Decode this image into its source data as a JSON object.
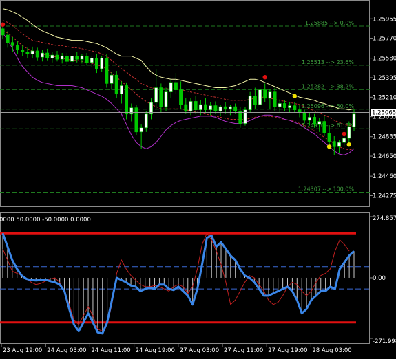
{
  "chart_data": [
    {
      "type": "candlestick",
      "panel": "price",
      "colors": {
        "background": "#000000",
        "bull": "#ffffff",
        "bear": "#00c800",
        "wick": "#00c800",
        "upper_band": "#f4f4a8",
        "lower_band": "#b030c8",
        "envelope": "#c03030",
        "fib": "#1f7a1f",
        "fib_text": "#3fa03f",
        "grid": "#8a8a8a",
        "marker_red": "#e01010",
        "marker_yellow": "#f0e000",
        "ask_line": "#9a9a9a"
      },
      "ylim": [
        1.2418,
        1.2612
      ],
      "y_ticks": [
        "1.25955",
        "1.25770",
        "1.25580",
        "1.25395",
        "1.25210",
        "1.25065",
        "1.24835",
        "1.24650",
        "1.24460",
        "1.24275"
      ],
      "y_tick_values": [
        1.25955,
        1.2577,
        1.2558,
        1.25395,
        1.2521,
        1.25025,
        1.24835,
        1.2465,
        1.2446,
        1.24275
      ],
      "current_price": 1.25065,
      "current_price_label": "1.25065",
      "fib_levels": [
        {
          "price": 1.25885,
          "label": "1.25885 --> 0.0%"
        },
        {
          "price": 1.25513,
          "label": "1.25513 --> 23.6%"
        },
        {
          "price": 1.25282,
          "label": "1.25282 --> 38.2%"
        },
        {
          "price": 1.25096,
          "label": "1.25096 --> 50.0%"
        },
        {
          "price": 1.2491,
          "label": "1.24910 --> 61.8%"
        },
        {
          "price": 1.24307,
          "label": "1.24307 --> 100.0%"
        }
      ],
      "candles": [
        [
          1.2586,
          1.2592,
          1.2576,
          1.258
        ],
        [
          1.258,
          1.2584,
          1.2568,
          1.2573
        ],
        [
          1.2573,
          1.2578,
          1.2564,
          1.257
        ],
        [
          1.257,
          1.2574,
          1.2562,
          1.2566
        ],
        [
          1.2566,
          1.257,
          1.256,
          1.2564
        ],
        [
          1.2564,
          1.2568,
          1.2558,
          1.2562
        ],
        [
          1.2562,
          1.2569,
          1.2558,
          1.2565
        ],
        [
          1.2565,
          1.2568,
          1.2556,
          1.2559
        ],
        [
          1.2559,
          1.2566,
          1.2555,
          1.2563
        ],
        [
          1.2563,
          1.2567,
          1.2556,
          1.2558
        ],
        [
          1.2558,
          1.2564,
          1.2554,
          1.2561
        ],
        [
          1.2561,
          1.2565,
          1.2555,
          1.2557
        ],
        [
          1.2557,
          1.2563,
          1.2553,
          1.256
        ],
        [
          1.256,
          1.2563,
          1.2552,
          1.2555
        ],
        [
          1.2555,
          1.2562,
          1.2552,
          1.256
        ],
        [
          1.256,
          1.2564,
          1.2554,
          1.2557
        ],
        [
          1.2557,
          1.2562,
          1.2553,
          1.256
        ],
        [
          1.256,
          1.2563,
          1.2551,
          1.2554
        ],
        [
          1.2554,
          1.256,
          1.255,
          1.2558
        ],
        [
          1.2558,
          1.2562,
          1.2544,
          1.2548
        ],
        [
          1.2548,
          1.256,
          1.2545,
          1.2558
        ],
        [
          1.2558,
          1.2562,
          1.253,
          1.2534
        ],
        [
          1.2534,
          1.2545,
          1.2528,
          1.2542
        ],
        [
          1.2542,
          1.2546,
          1.252,
          1.2524
        ],
        [
          1.2524,
          1.2536,
          1.2515,
          1.2532
        ],
        [
          1.2532,
          1.2535,
          1.25,
          1.2505
        ],
        [
          1.2505,
          1.2515,
          1.2498,
          1.2511
        ],
        [
          1.2511,
          1.2514,
          1.2485,
          1.2488
        ],
        [
          1.2488,
          1.2495,
          1.2472,
          1.2492
        ],
        [
          1.2492,
          1.2508,
          1.2488,
          1.2505
        ],
        [
          1.2505,
          1.252,
          1.25,
          1.2516
        ],
        [
          1.2516,
          1.2548,
          1.251,
          1.253
        ],
        [
          1.253,
          1.2534,
          1.2506,
          1.2512
        ],
        [
          1.2512,
          1.253,
          1.2508,
          1.2526
        ],
        [
          1.2526,
          1.2538,
          1.252,
          1.2535
        ],
        [
          1.2535,
          1.2544,
          1.2524,
          1.2528
        ],
        [
          1.2528,
          1.2536,
          1.251,
          1.2514
        ],
        [
          1.2514,
          1.252,
          1.2505,
          1.2508
        ],
        [
          1.2508,
          1.252,
          1.2504,
          1.2517
        ],
        [
          1.2517,
          1.2522,
          1.2505,
          1.2509
        ],
        [
          1.2509,
          1.2518,
          1.2504,
          1.2514
        ],
        [
          1.2514,
          1.252,
          1.2506,
          1.2509
        ],
        [
          1.2509,
          1.2516,
          1.2504,
          1.2513
        ],
        [
          1.2513,
          1.2517,
          1.2505,
          1.2508
        ],
        [
          1.2508,
          1.2514,
          1.2503,
          1.2512
        ],
        [
          1.2512,
          1.2516,
          1.2505,
          1.251
        ],
        [
          1.251,
          1.2514,
          1.2504,
          1.2512
        ],
        [
          1.2512,
          1.2515,
          1.2505,
          1.2508
        ],
        [
          1.2508,
          1.2512,
          1.2492,
          1.2496
        ],
        [
          1.2496,
          1.2512,
          1.2494,
          1.2509
        ],
        [
          1.2509,
          1.2526,
          1.2506,
          1.2522
        ],
        [
          1.2522,
          1.253,
          1.251,
          1.2514
        ],
        [
          1.2514,
          1.2532,
          1.251,
          1.2528
        ],
        [
          1.2528,
          1.2534,
          1.2516,
          1.252
        ],
        [
          1.252,
          1.2529,
          1.251,
          1.2526
        ],
        [
          1.2526,
          1.253,
          1.2508,
          1.2512
        ],
        [
          1.2512,
          1.2519,
          1.2506,
          1.2515
        ],
        [
          1.2515,
          1.2518,
          1.2508,
          1.2511
        ],
        [
          1.2511,
          1.2516,
          1.2506,
          1.2513
        ],
        [
          1.2513,
          1.2516,
          1.2506,
          1.2509
        ],
        [
          1.2509,
          1.2514,
          1.2502,
          1.2506
        ],
        [
          1.2506,
          1.2509,
          1.2496,
          1.2499
        ],
        [
          1.2499,
          1.2506,
          1.2494,
          1.2502
        ],
        [
          1.2502,
          1.2505,
          1.2492,
          1.2495
        ],
        [
          1.2495,
          1.2501,
          1.2488,
          1.2498
        ],
        [
          1.2498,
          1.2503,
          1.2484,
          1.2487
        ],
        [
          1.2487,
          1.2494,
          1.2476,
          1.2479
        ],
        [
          1.2479,
          1.2484,
          1.2466,
          1.2474
        ],
        [
          1.2474,
          1.248,
          1.2468,
          1.2478
        ],
        [
          1.2478,
          1.2486,
          1.2474,
          1.2482
        ],
        [
          1.2482,
          1.2498,
          1.2478,
          1.2493
        ],
        [
          1.2493,
          1.251,
          1.2489,
          1.2505
        ]
      ],
      "upper_band": [
        1.2605,
        1.2604,
        1.2602,
        1.26,
        1.2597,
        1.2594,
        1.259,
        1.2587,
        1.2584,
        1.2582,
        1.258,
        1.2578,
        1.2577,
        1.2576,
        1.2575,
        1.2575,
        1.2575,
        1.2574,
        1.2573,
        1.2572,
        1.257,
        1.2568,
        1.2565,
        1.2562,
        1.256,
        1.256,
        1.256,
        1.2558,
        1.2556,
        1.255,
        1.2545,
        1.2542,
        1.254,
        1.2539,
        1.2538,
        1.2538,
        1.2537,
        1.2536,
        1.2535,
        1.2534,
        1.2533,
        1.2532,
        1.2531,
        1.253,
        1.253,
        1.253,
        1.2531,
        1.2532,
        1.2534,
        1.2536,
        1.2538,
        1.2538,
        1.2537,
        1.2535,
        1.2533,
        1.2531,
        1.2529,
        1.2527,
        1.2525,
        1.2523,
        1.2521,
        1.252,
        1.2519,
        1.2518,
        1.2516,
        1.2515,
        1.2513,
        1.2512,
        1.251,
        1.251,
        1.2509,
        1.251
      ],
      "lower_band": [
        1.2582,
        1.2575,
        1.2567,
        1.2558,
        1.255,
        1.2545,
        1.254,
        1.2537,
        1.2535,
        1.2534,
        1.2533,
        1.2532,
        1.2532,
        1.2532,
        1.2532,
        1.2531,
        1.253,
        1.2528,
        1.2526,
        1.2524,
        1.2522,
        1.2519,
        1.2515,
        1.251,
        1.2505,
        1.2495,
        1.2485,
        1.2478,
        1.2474,
        1.2472,
        1.2474,
        1.2478,
        1.2484,
        1.249,
        1.2494,
        1.2497,
        1.2499,
        1.25,
        1.2501,
        1.2502,
        1.2503,
        1.2503,
        1.2503,
        1.2502,
        1.25,
        1.2498,
        1.2497,
        1.2496,
        1.2496,
        1.2497,
        1.2499,
        1.2501,
        1.2503,
        1.2504,
        1.2504,
        1.2503,
        1.2502,
        1.25,
        1.2499,
        1.2497,
        1.2495,
        1.2492,
        1.2489,
        1.2486,
        1.2482,
        1.2478,
        1.2474,
        1.247,
        1.2467,
        1.2466,
        1.2468,
        1.2472
      ],
      "envelope_upper": [
        1.2594,
        1.2592,
        1.2589,
        1.2585,
        1.2581,
        1.2578,
        1.2575,
        1.2574,
        1.2573,
        1.2572,
        1.2571,
        1.257,
        1.257,
        1.2569,
        1.2568,
        1.2568,
        1.2567,
        1.2566,
        1.2565,
        1.2564,
        1.2562,
        1.256,
        1.2556,
        1.2552,
        1.2548,
        1.2545,
        1.2541,
        1.2538,
        1.2534,
        1.2532,
        1.253,
        1.2529,
        1.2529,
        1.2529,
        1.2529,
        1.2529,
        1.2528,
        1.2527,
        1.2526,
        1.2525,
        1.2524,
        1.2523,
        1.2522,
        1.2521,
        1.252,
        1.2519,
        1.2518,
        1.2518,
        1.2518,
        1.2518,
        1.2519,
        1.252,
        1.2521,
        1.2521,
        1.252,
        1.2519,
        1.2518,
        1.2517,
        1.2516,
        1.2515,
        1.2514,
        1.2512,
        1.251,
        1.2508,
        1.2506,
        1.2504,
        1.2502,
        1.2499,
        1.2497,
        1.2495,
        1.2494,
        1.2494
      ],
      "envelope_lower": [
        1.2584,
        1.2582,
        1.2578,
        1.2574,
        1.257,
        1.2567,
        1.2565,
        1.2563,
        1.2562,
        1.2561,
        1.256,
        1.2559,
        1.2558,
        1.2557,
        1.2556,
        1.2556,
        1.2555,
        1.2554,
        1.2553,
        1.2552,
        1.255,
        1.2548,
        1.2544,
        1.254,
        1.2536,
        1.2532,
        1.2528,
        1.2524,
        1.252,
        1.2517,
        1.2514,
        1.2512,
        1.251,
        1.251,
        1.251,
        1.251,
        1.251,
        1.2509,
        1.2508,
        1.2507,
        1.2506,
        1.2505,
        1.2504,
        1.2503,
        1.2502,
        1.2501,
        1.25,
        1.25,
        1.25,
        1.25,
        1.2501,
        1.2502,
        1.2503,
        1.2503,
        1.2503,
        1.2502,
        1.2501,
        1.25,
        1.2499,
        1.2498,
        1.2496,
        1.2494,
        1.2492,
        1.2489,
        1.2486,
        1.2483,
        1.248,
        1.2477,
        1.2474,
        1.2472,
        1.2471,
        1.2472
      ],
      "markers": [
        {
          "index": 0,
          "price": 1.259,
          "color": "red"
        },
        {
          "index": 53,
          "price": 1.254,
          "color": "red"
        },
        {
          "index": 69,
          "price": 1.2486,
          "color": "red"
        },
        {
          "index": 59,
          "price": 1.2522,
          "color": "yellow"
        },
        {
          "index": 66,
          "price": 1.2474,
          "color": "yellow"
        },
        {
          "index": 70,
          "price": 1.2476,
          "color": "yellow"
        }
      ]
    },
    {
      "type": "line",
      "panel": "oscillator",
      "header": "0000 50.0000 -50.0000 0.0000",
      "ylim": [
        -271.998,
        274.857
      ],
      "y_ticks": [
        "274.857",
        "0.00",
        "-271.998"
      ],
      "y_tick_values": [
        274.857,
        0,
        -271.998
      ],
      "levels": {
        "upper_red": 200,
        "lower_red": -200,
        "upper_dashed": 50,
        "lower_dashed": -50
      },
      "colors": {
        "blue": "#3a86e8",
        "red": "#c02020",
        "level_red": "#e01010",
        "level_dashed": "#3a6ad8",
        "histogram": "#c8c8c8"
      },
      "blue_series": [
        200,
        140,
        80,
        40,
        10,
        -5,
        -10,
        -12,
        -10,
        -8,
        -15,
        -20,
        -30,
        -60,
        -140,
        -210,
        -240,
        -200,
        -160,
        -200,
        -245,
        -250,
        -200,
        -100,
        0,
        -10,
        -20,
        -35,
        -40,
        -60,
        -50,
        -45,
        -50,
        -30,
        -30,
        -50,
        -55,
        -40,
        -60,
        -80,
        -120,
        -50,
        60,
        180,
        190,
        140,
        160,
        130,
        100,
        80,
        40,
        10,
        0,
        -20,
        -50,
        -80,
        -80,
        -70,
        -60,
        -50,
        -40,
        -60,
        -100,
        -160,
        -140,
        -100,
        -80,
        -60,
        -60,
        -40,
        -50,
        40,
        70,
        100,
        120
      ],
      "red_series": [
        130,
        80,
        30,
        20,
        10,
        -5,
        -20,
        -30,
        -25,
        -15,
        -5,
        0,
        -20,
        -60,
        -120,
        -190,
        -210,
        -170,
        -130,
        -170,
        -230,
        -240,
        -210,
        -120,
        20,
        80,
        40,
        10,
        -10,
        -30,
        -40,
        -40,
        -35,
        -40,
        -50,
        -60,
        -40,
        -30,
        -40,
        -70,
        -40,
        40,
        150,
        200,
        170,
        120,
        60,
        -20,
        -120,
        -100,
        -60,
        -20,
        10,
        0,
        -30,
        -60,
        -100,
        -120,
        -110,
        -80,
        -40,
        -20,
        -30,
        -60,
        -80,
        -60,
        -20,
        10,
        20,
        40,
        120,
        170,
        150,
        120
      ],
      "histogram": [
        200,
        140,
        80,
        40,
        10,
        -5,
        -10,
        -12,
        -10,
        -8,
        -15,
        -20,
        -30,
        -60,
        -140,
        -210,
        -240,
        -200,
        -160,
        -200,
        -245,
        -250,
        -200,
        -100,
        0,
        -10,
        -20,
        -35,
        -40,
        -60,
        -50,
        -45,
        -50,
        -30,
        -30,
        -50,
        -55,
        -40,
        -60,
        -80,
        -120,
        -50,
        60,
        180,
        190,
        140,
        160,
        130,
        100,
        80,
        40,
        10,
        0,
        -20,
        -50,
        -80,
        -80,
        -70,
        -60,
        -50,
        -40,
        -60,
        -100,
        -160,
        -140,
        -100,
        -80,
        -60,
        -60,
        -40,
        -50,
        40,
        70,
        100,
        120
      ],
      "x_labels": [
        "23 Aug 19:00",
        "24 Aug 03:00",
        "24 Aug 11:00",
        "24 Aug 19:00",
        "27 Aug 03:00",
        "27 Aug 11:00",
        "27 Aug 19:00",
        "28 Aug 03:00"
      ]
    }
  ]
}
